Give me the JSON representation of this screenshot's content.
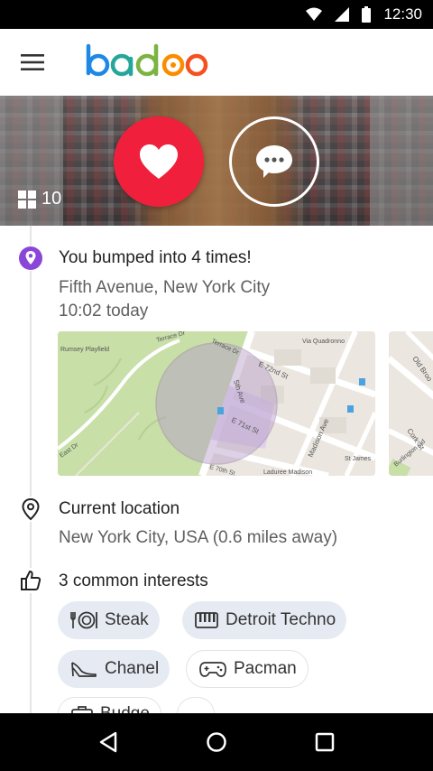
{
  "status_bar": {
    "time": "12:30"
  },
  "app": {
    "logo_text": "badoo"
  },
  "hero": {
    "photo_count": "10"
  },
  "encounters": {
    "title": "You bumped into 4 times!",
    "place": "Fifth Avenue, New York City",
    "time": "10:02 today"
  },
  "map": {
    "labels": [
      "Rumsey Playfield",
      "Terrace Dr",
      "Terrace Dr",
      "Via Quadronno",
      "E 72nd St",
      "5th Ave",
      "E 71st St",
      "Madison Ave",
      "St James",
      "E 70th St",
      "Laduree Madison",
      "East Dr",
      "Old Broo",
      "Cork St",
      "Burlington Gd"
    ]
  },
  "location": {
    "title": "Current location",
    "value": "New York City, USA (0.6 miles away)"
  },
  "interests": {
    "title": "3 common interests",
    "chips": [
      {
        "label": "Steak",
        "icon": "fork-plate-icon",
        "style": "filled"
      },
      {
        "label": "Detroit Techno",
        "icon": "piano-icon",
        "style": "filled"
      },
      {
        "label": "Chanel",
        "icon": "high-heel-icon",
        "style": "filled"
      },
      {
        "label": "Pacman",
        "icon": "gamepad-icon",
        "style": "outline"
      },
      {
        "label": "Budge",
        "icon": "briefcase-icon",
        "style": "outline"
      }
    ]
  },
  "colors": {
    "brand_red": "#f0203d",
    "location_purple": "#8a46d8",
    "chip_bg": "#e6ebf3"
  }
}
